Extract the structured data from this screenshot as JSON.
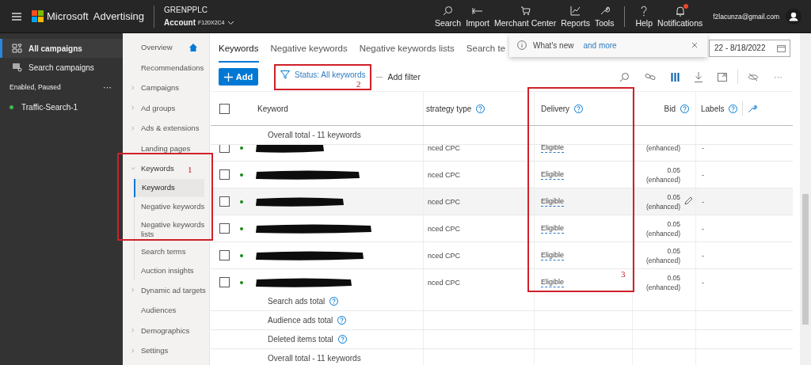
{
  "top_bar": {
    "brand": "Microsoft",
    "product": "Advertising",
    "customer": "GRENPPLC",
    "account_label": "Account",
    "account_id": "F120X2C4",
    "actions": [
      {
        "label": "Search",
        "kind": "search",
        "alert": false
      },
      {
        "label": "Import",
        "kind": "import",
        "alert": false
      },
      {
        "label": "Merchant Center",
        "kind": "cart",
        "alert": false
      },
      {
        "label": "Reports",
        "kind": "chart",
        "alert": false
      },
      {
        "label": "Tools",
        "kind": "tools",
        "alert": false
      },
      {
        "label": "Help",
        "kind": "help",
        "alert": false
      },
      {
        "label": "Notifications",
        "kind": "bell",
        "alert": true
      }
    ],
    "user_email": "f2lacunza@gmail.com"
  },
  "campaign_nav": {
    "items": [
      {
        "label": "All campaigns",
        "kind": "all",
        "selected": true
      },
      {
        "label": "Search campaigns",
        "kind": "search",
        "selected": false
      }
    ],
    "filter": "Enabled, Paused",
    "more": "···",
    "campaigns": [
      {
        "name": "Traffic-Search-1"
      }
    ]
  },
  "page_nav": [
    {
      "label": "Overview",
      "kind": "home",
      "expandable": false,
      "expanded": false
    },
    {
      "label": "Recommendations",
      "kind": "plain",
      "expandable": false,
      "expanded": false
    },
    {
      "label": "Campaigns",
      "kind": "plain",
      "expandable": true,
      "expanded": false
    },
    {
      "label": "Ad groups",
      "kind": "plain",
      "expandable": true,
      "expanded": false
    },
    {
      "label": "Ads & extensions",
      "kind": "plain",
      "expandable": true,
      "expanded": false
    },
    {
      "label": "Landing pages",
      "kind": "plain",
      "expandable": false,
      "expanded": false
    },
    {
      "label": "Keywords",
      "kind": "plain",
      "expandable": true,
      "expanded": true,
      "children": [
        {
          "label": "Keywords",
          "selected": true
        },
        {
          "label": "Negative keywords",
          "selected": false
        },
        {
          "label": "Negative keywords lists",
          "selected": false
        },
        {
          "label": "Search terms",
          "selected": false
        },
        {
          "label": "Auction insights",
          "selected": false
        }
      ]
    },
    {
      "label": "Dynamic ad targets",
      "kind": "plain",
      "expandable": true,
      "expanded": false
    },
    {
      "label": "Audiences",
      "kind": "plain",
      "expandable": false,
      "expanded": false
    },
    {
      "label": "Demographics",
      "kind": "plain",
      "expandable": true,
      "expanded": false
    },
    {
      "label": "Settings",
      "kind": "plain",
      "expandable": true,
      "expanded": false
    }
  ],
  "tabs": [
    {
      "label": "Keywords",
      "selected": true
    },
    {
      "label": "Negative keywords",
      "selected": false
    },
    {
      "label": "Negative keywords lists",
      "selected": false
    },
    {
      "label": "Search te",
      "selected": false
    }
  ],
  "notice": {
    "text": "What's new",
    "link": "and more"
  },
  "date_range": "22 - 8/18/2022",
  "toolbar": {
    "add": "Add",
    "filter": "Status: All keywords",
    "add_filter": "Add filter",
    "more": "···"
  },
  "table": {
    "header_checked": false,
    "columns": [
      {
        "label": "Keyword",
        "help": false
      },
      {
        "label": "strategy type",
        "help": true
      },
      {
        "label": "Delivery",
        "help": true
      },
      {
        "label": "Bid",
        "help": true
      },
      {
        "label": "Labels",
        "help": true
      }
    ],
    "overall_top": "Overall total - 11 keywords",
    "rows": [
      {
        "checked": false,
        "strategy": "nced CPC",
        "delivery": "Eligible",
        "bid_note": "(enhanced)",
        "labels": "-",
        "hovered": false
      },
      {
        "checked": false,
        "strategy": "nced CPC",
        "delivery": "Eligible",
        "bid": "0.05",
        "bid_note": "(enhanced)",
        "labels": "-",
        "hovered": false
      },
      {
        "checked": false,
        "strategy": "nced CPC",
        "delivery": "Eligible",
        "bid": "0.05",
        "bid_note": "(enhanced)",
        "labels": "-",
        "hovered": true
      },
      {
        "checked": false,
        "strategy": "nced CPC",
        "delivery": "Eligible",
        "bid": "0.05",
        "bid_note": "(enhanced)",
        "labels": "-",
        "hovered": false
      },
      {
        "checked": false,
        "strategy": "nced CPC",
        "delivery": "Eligible",
        "bid": "0.05",
        "bid_note": "(enhanced)",
        "labels": "-",
        "hovered": false
      },
      {
        "checked": false,
        "strategy": "nced CPC",
        "delivery": "Eligible",
        "bid": "0.05",
        "bid_note": "(enhanced)",
        "labels": "-",
        "hovered": false
      }
    ],
    "totals": [
      {
        "label": "Search ads total",
        "help": true
      },
      {
        "label": "Audience ads total",
        "help": true
      },
      {
        "label": "Deleted items total",
        "help": true
      },
      {
        "label": "Overall total - 11 keywords",
        "help": false
      }
    ]
  },
  "annotations": [
    "1",
    "2",
    "3"
  ]
}
